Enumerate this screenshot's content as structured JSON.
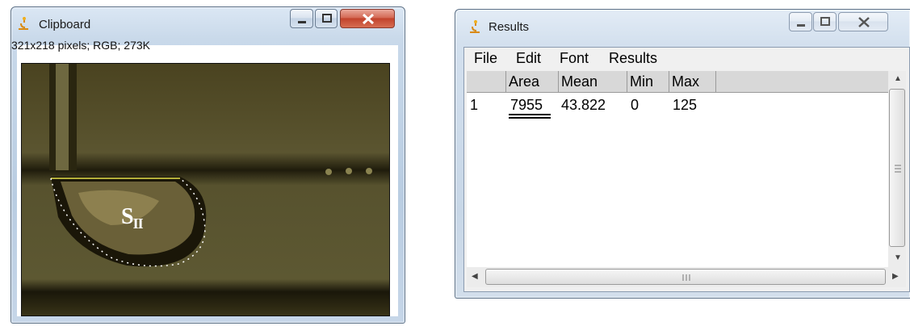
{
  "clipboard_window": {
    "title": "Clipboard",
    "image_info": "321x218 pixels; RGB; 273K",
    "label_main": "S",
    "label_sub": "II"
  },
  "results_window": {
    "title": "Results",
    "menu": [
      "File",
      "Edit",
      "Font",
      "Results"
    ],
    "columns": [
      "",
      "Area",
      "Mean",
      "Min",
      "Max"
    ],
    "rows": [
      {
        "index": "1",
        "area": "7955",
        "mean": "43.822",
        "min": "0",
        "max": "125"
      }
    ]
  },
  "colors": {
    "selection_line": "#e8e24a",
    "roi_dots": "#ffffff",
    "image_background": "#3f3a1c"
  },
  "icons": {
    "app_icon": "microscope-icon",
    "minimize": "minimize-icon",
    "maximize": "maximize-icon",
    "close": "close-icon"
  }
}
